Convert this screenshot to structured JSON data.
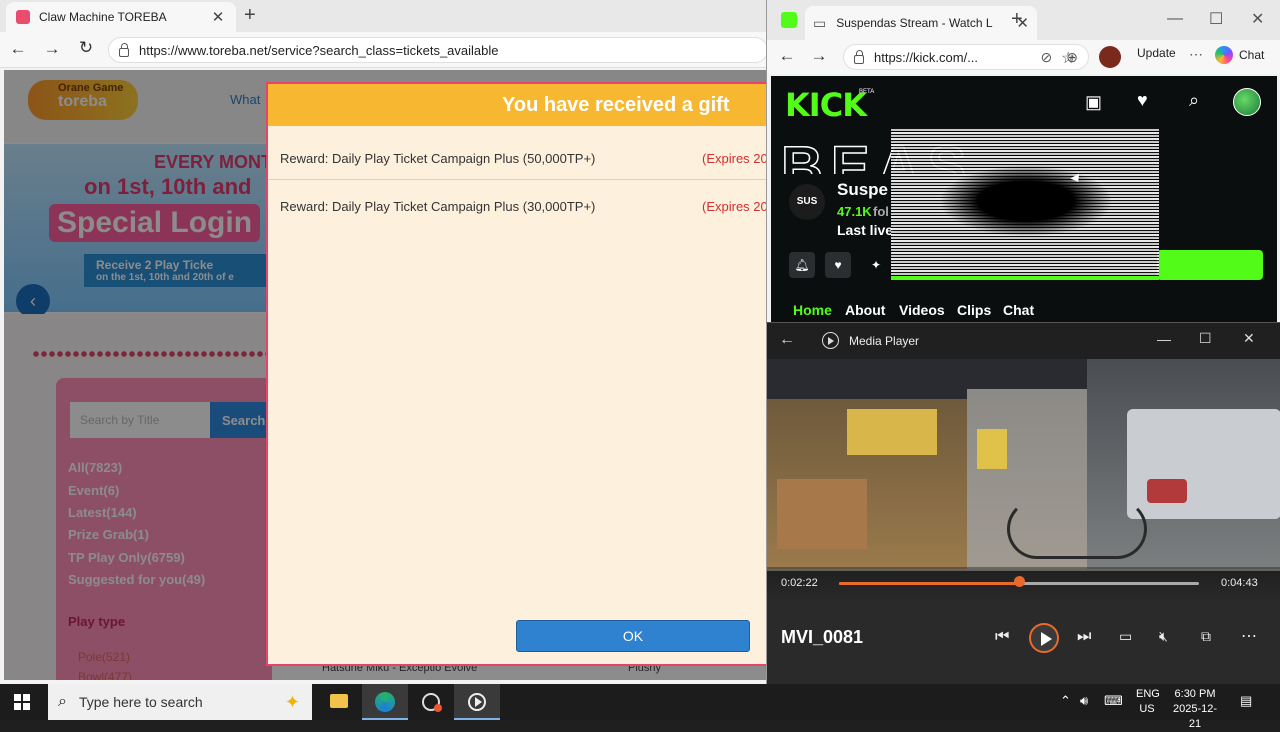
{
  "left_browser": {
    "tab_title": "Claw Machine TOREBA",
    "url": "https://www.toreba.net/service?search_class=tickets_available"
  },
  "toreba": {
    "logo_line1": "Orane Game",
    "logo_line2": "toreba",
    "nav_partial": "What",
    "banner_line1": "EVERY MONTH",
    "banner_line2": "on 1st, 10th and",
    "banner_line3": "Special Login",
    "banner_line4": "Receive 2 Play Ticke",
    "banner_line5": "on the 1st, 10th and 20th of e",
    "search_placeholder": "Search by Title",
    "search_button": "Search",
    "categories": [
      "All(7823)",
      "Event(6)",
      "Latest(144)",
      "Prize Grab(1)",
      "TP Play Only(6759)",
      "Suggested for you(49)"
    ],
    "play_type_heading": "Play type",
    "play_types": [
      "Pole(521)",
      "Bowl(477)"
    ],
    "bottom_item": "Hatsune Miku - Exceptio Evolve",
    "bottom_item2": "Plushy"
  },
  "gift_dialog": {
    "title": "You have received a gift",
    "rewards": [
      {
        "name": "Reward: Daily Play Ticket Campaign Plus (50,000TP+)",
        "expires": "(Expires 20"
      },
      {
        "name": "Reward: Daily Play Ticket Campaign Plus (30,000TP+)",
        "expires": "(Expires 20"
      }
    ],
    "ok_label": "OK"
  },
  "right_browser": {
    "tab_title": "Suspendas Stream - Watch L",
    "url": "https://kick.com/...",
    "update_label": "Update",
    "chat_label": "Chat"
  },
  "kick": {
    "logo": "KICK",
    "beta": "BETA",
    "channel_name": "Suspe",
    "channel_avatar_text": "SUS",
    "followers_count": "47.1K",
    "followers_label": "fol",
    "last_live": "Last live",
    "nav": [
      "Home",
      "About",
      "Videos",
      "Clips",
      "Chat"
    ]
  },
  "media_player": {
    "title": "Media Player",
    "current_time": "0:02:22",
    "total_time": "0:04:43",
    "progress_fraction": 0.5,
    "file_name": "MVI_0081"
  },
  "taskbar": {
    "search_placeholder": "Type here to search",
    "lang_line1": "ENG",
    "lang_line2": "US",
    "time": "6:30 PM",
    "date": "2025-12-21"
  },
  "colors": {
    "kick_green": "#53fc18",
    "gift_header": "#f7b731",
    "ok_button": "#2e82cf",
    "seek_accent": "#e96a2a"
  }
}
